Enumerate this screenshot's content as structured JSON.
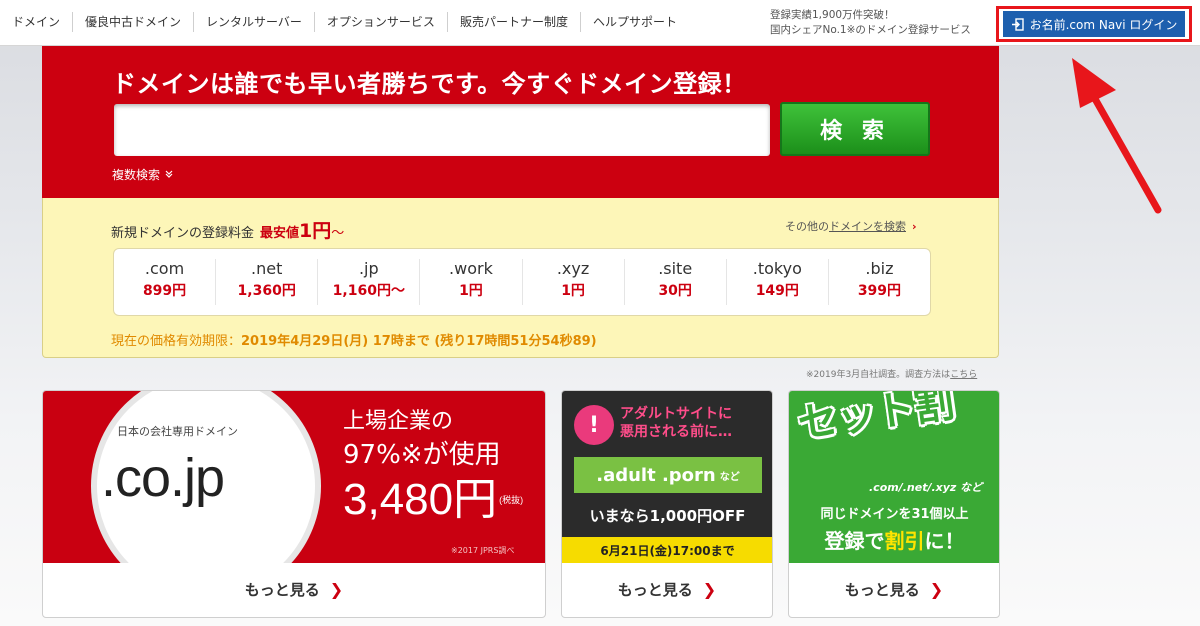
{
  "nav": {
    "items": [
      "ドメイン",
      "優良中古ドメイン",
      "レンタルサーバー",
      "オプションサービス",
      "販売パートナー制度",
      "ヘルプサポート"
    ]
  },
  "stats": {
    "line1": "登録実績1,900万件突破！",
    "line2": "国内シェアNo.1※のドメイン登録サービス"
  },
  "login": {
    "label": "お名前.com Navi ログイン",
    "icon": "login-icon"
  },
  "search": {
    "headline": "ドメインは誰でも早い者勝ちです。今すぐドメイン登録！",
    "input_value": "",
    "button_label": "検 索",
    "multi_search_label": "複数検索",
    "multi_search_icon": "double-chevron-down-icon"
  },
  "pricing": {
    "title": "新規ドメインの登録料金",
    "min_label": "最安値",
    "min_value": "1円",
    "min_suffix": "～",
    "other_link_prefix": "その他の",
    "other_link_text": "ドメインを検索",
    "tlds": [
      {
        "name": ".com",
        "price": "899円"
      },
      {
        "name": ".net",
        "price": "1,360円"
      },
      {
        "name": ".jp",
        "price": "1,160円～"
      },
      {
        "name": ".work",
        "price": "1円"
      },
      {
        "name": ".xyz",
        "price": "1円"
      },
      {
        "name": ".site",
        "price": "30円"
      },
      {
        "name": ".tokyo",
        "price": "149円"
      },
      {
        "name": ".biz",
        "price": "399円"
      }
    ],
    "validity_label": "現在の価格有効期限：",
    "validity_value": "2019年4月29日(月) 17時まで (残り17時間51分54秒89)",
    "survey_note": "※2019年3月自社調査。調査方法は",
    "survey_link": "こちら"
  },
  "banners": {
    "cojp": {
      "sub": "日本の会社専用ドメイン",
      "big": ".co.jp",
      "line1": "上場企業の",
      "line2": "97%※が使用",
      "price": "3,480円",
      "tax": "(税抜)",
      "note": "※2017 JPRS調べ",
      "more": "もっと見る"
    },
    "adult": {
      "warn_line1": "アダルトサイトに",
      "warn_line2": "悪用される前に…",
      "tlds": ".adult .porn",
      "tlds_etc": "など",
      "offer": "いまなら1,000円OFF",
      "deadline": "6月21日(金)17:00まで",
      "more": "もっと見る"
    },
    "set": {
      "title": "セット割",
      "sub": ".com/.net/.xyz など",
      "line1": "同じドメインを31個以上",
      "line2_a": "登録で",
      "line2_b": "割引",
      "line2_c": "に！",
      "more": "もっと見る"
    }
  },
  "colors": {
    "brand_red": "#cc0010",
    "login_blue": "#1d5fae",
    "search_green": "#2aa52a",
    "price_yellow": "#fdf6b8",
    "annotation_red": "#e8161b"
  }
}
